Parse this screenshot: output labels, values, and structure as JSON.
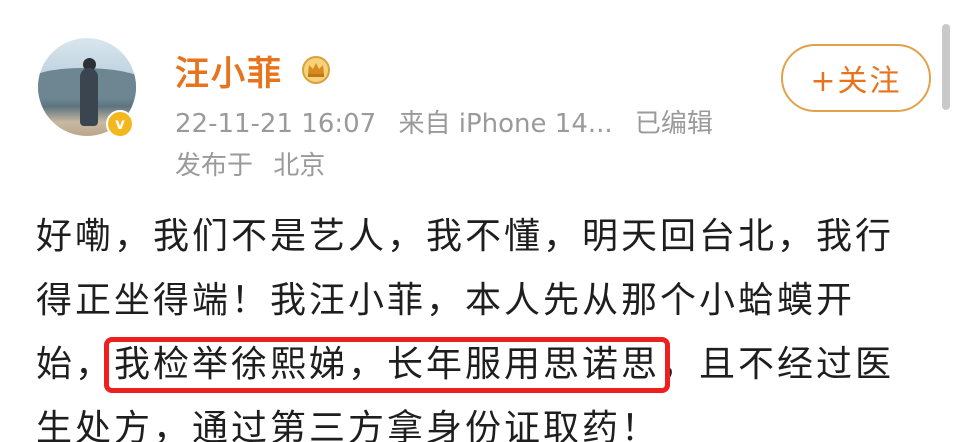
{
  "post": {
    "author": {
      "name": "汪小菲",
      "verified_icon": "verified-badge-icon",
      "crown_icon": "vip-crown-icon"
    },
    "meta": {
      "date": "22-11-21 16:07",
      "source": "来自 iPhone 14...",
      "edited": "已编辑",
      "location_prefix": "发布于",
      "location": "北京"
    },
    "follow_label": "+关注",
    "text_lines": [
      "好嘞，我们不是艺人，我不懂，明天回台北，我行",
      "得正坐得端！我汪小菲，本人先从那个小蛤蟆开"
    ],
    "line3_before": "始，",
    "line3_highlight": "我检举徐熙娣，长年服用思诺思",
    "line3_after": "，且不经过医",
    "line4": "生处方，通过第三方拿身份证取药！"
  },
  "colors": {
    "name": "#e8731d",
    "meta": "#9a9a9a",
    "highlight_border": "#ee1f1f",
    "follow_border": "#e0a24a",
    "verified": "#f3b81e"
  }
}
